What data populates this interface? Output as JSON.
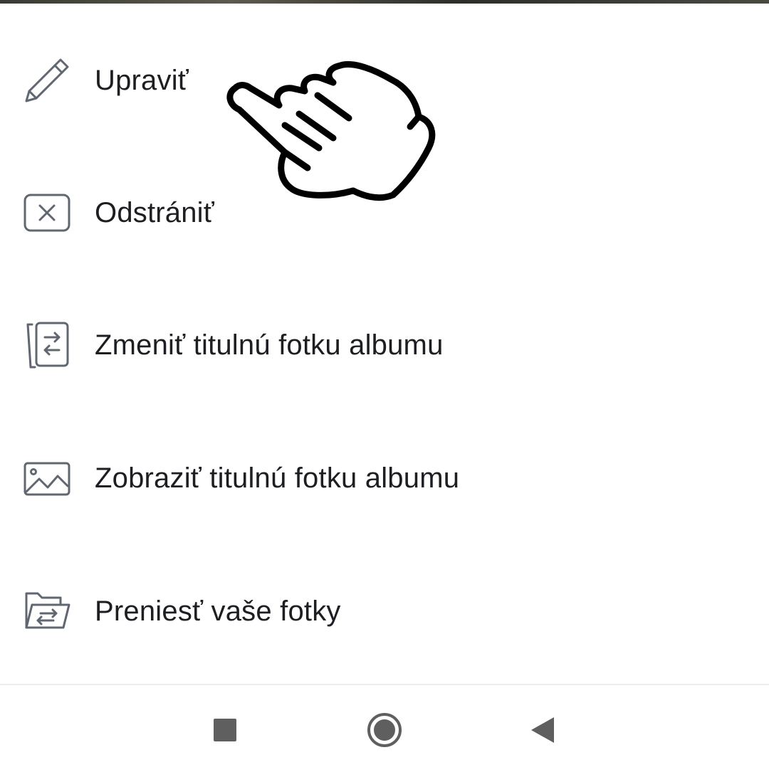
{
  "menu": {
    "items": [
      {
        "label": "Upraviť",
        "icon": "pencil-icon"
      },
      {
        "label": "Odstrániť",
        "icon": "close-box-icon"
      },
      {
        "label": "Zmeniť titulnú fotku albumu",
        "icon": "swap-photo-icon"
      },
      {
        "label": "Zobraziť titulnú fotku albumu",
        "icon": "image-icon"
      },
      {
        "label": "Preniesť vaše fotky",
        "icon": "folder-transfer-icon"
      }
    ]
  },
  "overlay": {
    "icon": "pointing-hand-icon"
  },
  "navbar": {
    "recents_icon": "square-icon",
    "home_icon": "circle-icon",
    "back_icon": "triangle-back-icon"
  },
  "colors": {
    "text": "#1c1e21",
    "icon": "#606770",
    "nav_icon": "#5f5f5f"
  }
}
